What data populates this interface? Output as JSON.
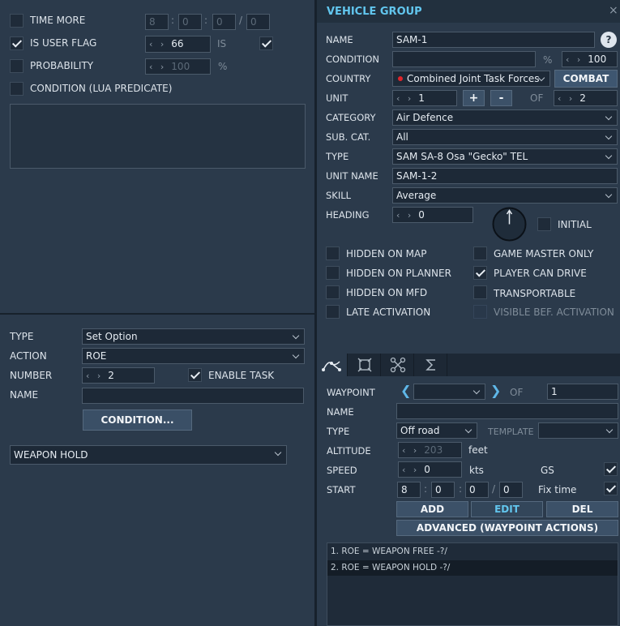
{
  "left": {
    "conditions": {
      "time_more": {
        "label": "TIME MORE",
        "h": "8",
        "m": "0",
        "s": "0",
        "d": "0",
        "checked": false
      },
      "user_flag": {
        "label": "IS USER FLAG",
        "value": "66",
        "is_label": "IS",
        "checked": true,
        "is_checked": true
      },
      "probability": {
        "label": "PROBABILITY",
        "value": "100",
        "unit": "%",
        "checked": false
      },
      "lua": {
        "label": "CONDITION (LUA PREDICATE)",
        "checked": false,
        "text": ""
      }
    },
    "action": {
      "type_label": "TYPE",
      "type_value": "Set Option",
      "action_label": "ACTION",
      "action_value": "ROE",
      "number_label": "NUMBER",
      "number_value": "2",
      "enable_task_label": "ENABLE TASK",
      "enable_task_checked": true,
      "name_label": "NAME",
      "name_value": "",
      "condition_button": "CONDITION...",
      "option_value": "WEAPON HOLD"
    }
  },
  "vg": {
    "title": "VEHICLE GROUP",
    "close": "×",
    "name_label": "NAME",
    "name_value": "SAM-1",
    "help": "?",
    "condition_label": "CONDITION",
    "condition_value": "",
    "cond_pct": "%",
    "cond_prob": "100",
    "country_label": "COUNTRY",
    "country_value": "Combined Joint Task Forces",
    "country_color": "#e0252b",
    "combat_button": "COMBAT",
    "unit_label": "UNIT",
    "unit_value": "1",
    "plus": "+",
    "minus": "-",
    "of_label": "OF",
    "unit_of": "2",
    "category_label": "CATEGORY",
    "category_value": "Air Defence",
    "subcat_label": "SUB. CAT.",
    "subcat_value": "All",
    "type_label": "TYPE",
    "type_value": "SAM SA-8 Osa \"Gecko\" TEL",
    "unitname_label": "UNIT NAME",
    "unitname_value": "SAM-1-2",
    "skill_label": "SKILL",
    "skill_value": "Average",
    "heading_label": "HEADING",
    "heading_value": "0",
    "initial_label": "INITIAL",
    "flags": {
      "hidden_map": {
        "label": "HIDDEN ON MAP",
        "checked": false
      },
      "hidden_planner": {
        "label": "HIDDEN ON PLANNER",
        "checked": false
      },
      "hidden_mfd": {
        "label": "HIDDEN ON MFD",
        "checked": false
      },
      "late_activation": {
        "label": "LATE ACTIVATION",
        "checked": false
      },
      "game_master": {
        "label": "GAME MASTER ONLY",
        "checked": false
      },
      "player_drive": {
        "label": "PLAYER CAN DRIVE",
        "checked": true
      },
      "transportable": {
        "label": "TRANSPORTABLE",
        "checked": false
      },
      "visible_bef": {
        "label": "VISIBLE BEF. ACTIVATION",
        "checked": false
      }
    }
  },
  "wp": {
    "tabs": [
      "route-icon",
      "target-icon",
      "nodes-icon",
      "sigma-icon"
    ],
    "waypoint_label": "WAYPOINT",
    "waypoint_value": "",
    "of_label": "OF",
    "of_value": "1",
    "name_label": "NAME",
    "name_value": "",
    "type_label": "TYPE",
    "type_value": "Off road",
    "template_label": "TEMPLATE",
    "template_value": "",
    "altitude_label": "ALTITUDE",
    "altitude_value": "203",
    "altitude_unit": "feet",
    "speed_label": "SPEED",
    "speed_value": "0",
    "speed_unit": "kts",
    "gs_label": "GS",
    "gs_checked": true,
    "start_label": "START",
    "start_h": "8",
    "start_m": "0",
    "start_s": "0",
    "start_d": "0",
    "fix_label": "Fix time",
    "fix_checked": true,
    "add": "ADD",
    "edit": "EDIT",
    "del": "DEL",
    "advanced": "ADVANCED (WAYPOINT ACTIONS)",
    "actions": [
      "1. ROE = WEAPON FREE -?/",
      "2. ROE = WEAPON HOLD -?/"
    ]
  }
}
